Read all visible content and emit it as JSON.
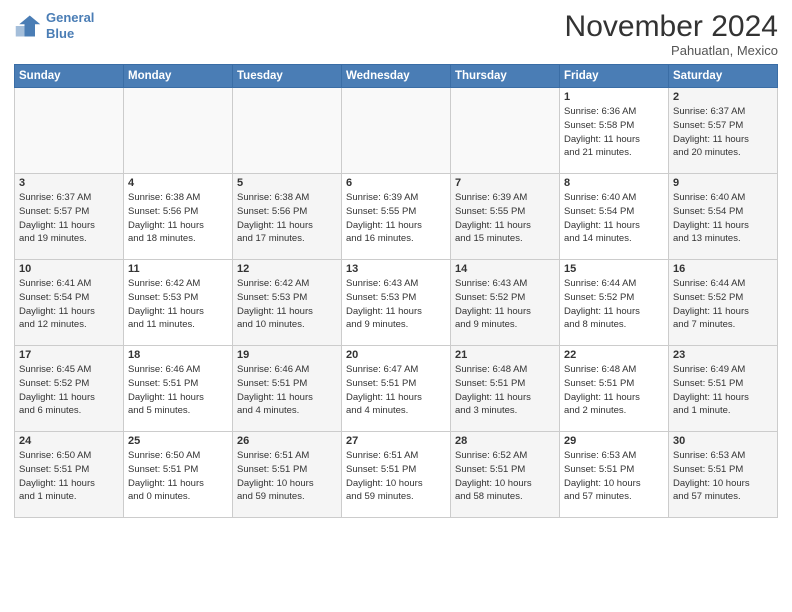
{
  "header": {
    "logo_line1": "General",
    "logo_line2": "Blue",
    "month": "November 2024",
    "location": "Pahuatlan, Mexico"
  },
  "weekdays": [
    "Sunday",
    "Monday",
    "Tuesday",
    "Wednesday",
    "Thursday",
    "Friday",
    "Saturday"
  ],
  "weeks": [
    [
      {
        "day": "",
        "info": ""
      },
      {
        "day": "",
        "info": ""
      },
      {
        "day": "",
        "info": ""
      },
      {
        "day": "",
        "info": ""
      },
      {
        "day": "",
        "info": ""
      },
      {
        "day": "1",
        "info": "Sunrise: 6:36 AM\nSunset: 5:58 PM\nDaylight: 11 hours\nand 21 minutes."
      },
      {
        "day": "2",
        "info": "Sunrise: 6:37 AM\nSunset: 5:57 PM\nDaylight: 11 hours\nand 20 minutes."
      }
    ],
    [
      {
        "day": "3",
        "info": "Sunrise: 6:37 AM\nSunset: 5:57 PM\nDaylight: 11 hours\nand 19 minutes."
      },
      {
        "day": "4",
        "info": "Sunrise: 6:38 AM\nSunset: 5:56 PM\nDaylight: 11 hours\nand 18 minutes."
      },
      {
        "day": "5",
        "info": "Sunrise: 6:38 AM\nSunset: 5:56 PM\nDaylight: 11 hours\nand 17 minutes."
      },
      {
        "day": "6",
        "info": "Sunrise: 6:39 AM\nSunset: 5:55 PM\nDaylight: 11 hours\nand 16 minutes."
      },
      {
        "day": "7",
        "info": "Sunrise: 6:39 AM\nSunset: 5:55 PM\nDaylight: 11 hours\nand 15 minutes."
      },
      {
        "day": "8",
        "info": "Sunrise: 6:40 AM\nSunset: 5:54 PM\nDaylight: 11 hours\nand 14 minutes."
      },
      {
        "day": "9",
        "info": "Sunrise: 6:40 AM\nSunset: 5:54 PM\nDaylight: 11 hours\nand 13 minutes."
      }
    ],
    [
      {
        "day": "10",
        "info": "Sunrise: 6:41 AM\nSunset: 5:54 PM\nDaylight: 11 hours\nand 12 minutes."
      },
      {
        "day": "11",
        "info": "Sunrise: 6:42 AM\nSunset: 5:53 PM\nDaylight: 11 hours\nand 11 minutes."
      },
      {
        "day": "12",
        "info": "Sunrise: 6:42 AM\nSunset: 5:53 PM\nDaylight: 11 hours\nand 10 minutes."
      },
      {
        "day": "13",
        "info": "Sunrise: 6:43 AM\nSunset: 5:53 PM\nDaylight: 11 hours\nand 9 minutes."
      },
      {
        "day": "14",
        "info": "Sunrise: 6:43 AM\nSunset: 5:52 PM\nDaylight: 11 hours\nand 9 minutes."
      },
      {
        "day": "15",
        "info": "Sunrise: 6:44 AM\nSunset: 5:52 PM\nDaylight: 11 hours\nand 8 minutes."
      },
      {
        "day": "16",
        "info": "Sunrise: 6:44 AM\nSunset: 5:52 PM\nDaylight: 11 hours\nand 7 minutes."
      }
    ],
    [
      {
        "day": "17",
        "info": "Sunrise: 6:45 AM\nSunset: 5:52 PM\nDaylight: 11 hours\nand 6 minutes."
      },
      {
        "day": "18",
        "info": "Sunrise: 6:46 AM\nSunset: 5:51 PM\nDaylight: 11 hours\nand 5 minutes."
      },
      {
        "day": "19",
        "info": "Sunrise: 6:46 AM\nSunset: 5:51 PM\nDaylight: 11 hours\nand 4 minutes."
      },
      {
        "day": "20",
        "info": "Sunrise: 6:47 AM\nSunset: 5:51 PM\nDaylight: 11 hours\nand 4 minutes."
      },
      {
        "day": "21",
        "info": "Sunrise: 6:48 AM\nSunset: 5:51 PM\nDaylight: 11 hours\nand 3 minutes."
      },
      {
        "day": "22",
        "info": "Sunrise: 6:48 AM\nSunset: 5:51 PM\nDaylight: 11 hours\nand 2 minutes."
      },
      {
        "day": "23",
        "info": "Sunrise: 6:49 AM\nSunset: 5:51 PM\nDaylight: 11 hours\nand 1 minute."
      }
    ],
    [
      {
        "day": "24",
        "info": "Sunrise: 6:50 AM\nSunset: 5:51 PM\nDaylight: 11 hours\nand 1 minute."
      },
      {
        "day": "25",
        "info": "Sunrise: 6:50 AM\nSunset: 5:51 PM\nDaylight: 11 hours\nand 0 minutes."
      },
      {
        "day": "26",
        "info": "Sunrise: 6:51 AM\nSunset: 5:51 PM\nDaylight: 10 hours\nand 59 minutes."
      },
      {
        "day": "27",
        "info": "Sunrise: 6:51 AM\nSunset: 5:51 PM\nDaylight: 10 hours\nand 59 minutes."
      },
      {
        "day": "28",
        "info": "Sunrise: 6:52 AM\nSunset: 5:51 PM\nDaylight: 10 hours\nand 58 minutes."
      },
      {
        "day": "29",
        "info": "Sunrise: 6:53 AM\nSunset: 5:51 PM\nDaylight: 10 hours\nand 57 minutes."
      },
      {
        "day": "30",
        "info": "Sunrise: 6:53 AM\nSunset: 5:51 PM\nDaylight: 10 hours\nand 57 minutes."
      }
    ]
  ]
}
